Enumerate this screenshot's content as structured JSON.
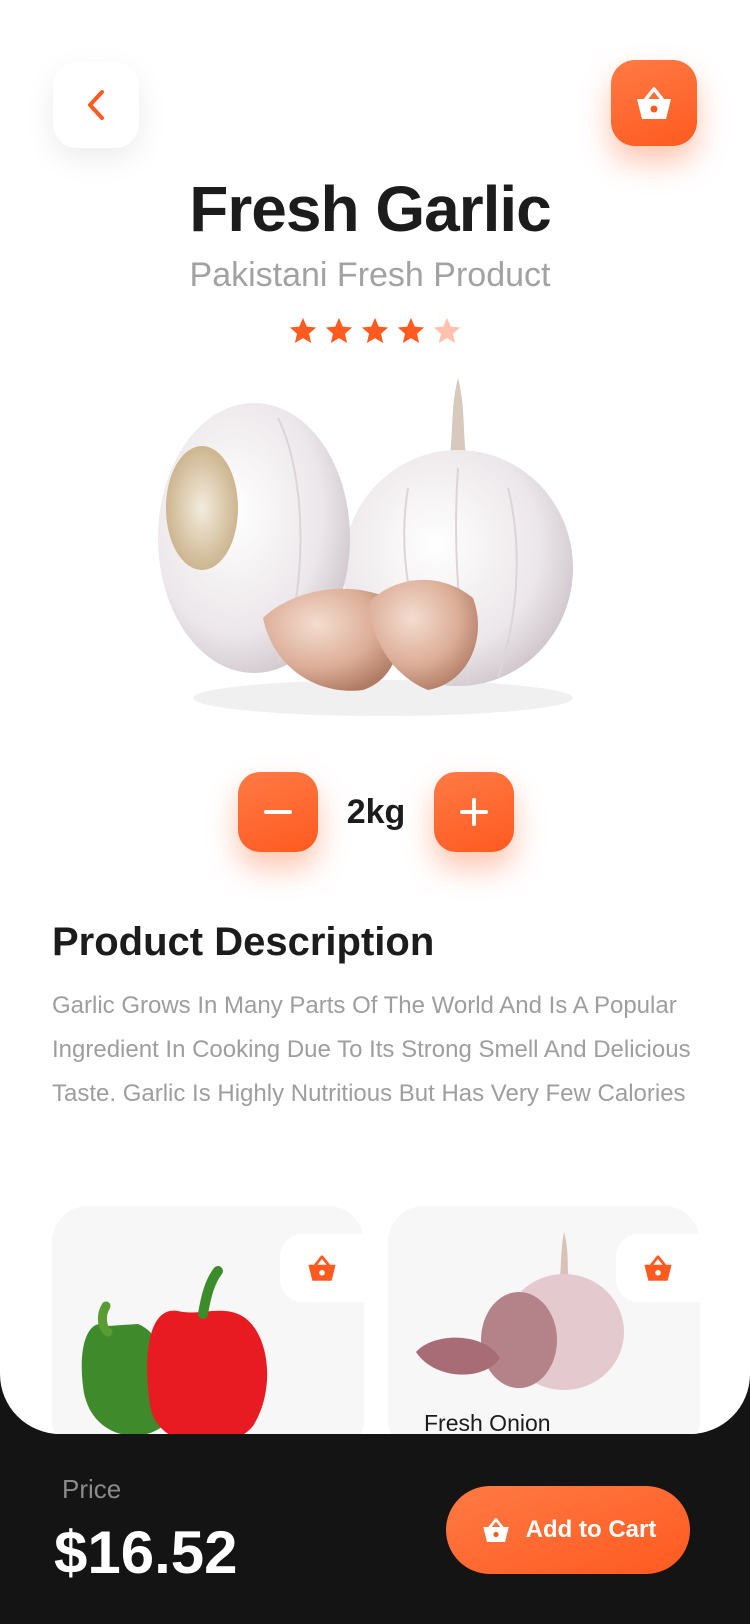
{
  "header": {
    "back_icon": "chevron-left-icon",
    "cart_icon": "basket-icon"
  },
  "product": {
    "title": "Fresh Garlic",
    "subtitle": "Pakistani Fresh Product",
    "rating": {
      "value": 4,
      "max": 5
    },
    "image": "garlic-bulbs-image"
  },
  "quantity": {
    "value": "2kg",
    "minus_icon": "minus-icon",
    "plus_icon": "plus-icon"
  },
  "description": {
    "heading": "Product Description",
    "text": "Garlic Grows In Many Parts Of The World And Is A Popular Ingredient In Cooking Due To Its Strong Smell And Delicious Taste. Garlic Is Highly Nutritious But Has Very Few Calories"
  },
  "related": [
    {
      "name": "",
      "image": "bell-peppers-image"
    },
    {
      "name": "Fresh Onion",
      "image": "onion-image"
    }
  ],
  "footer": {
    "price_label": "Price",
    "price_value": "$16.52",
    "add_to_cart_label": "Add to Cart"
  },
  "colors": {
    "accent": "#ff5a1f",
    "accent_light": "#ff7a45",
    "star_inactive": "#ffc2ad",
    "footer_bg": "#141414"
  }
}
